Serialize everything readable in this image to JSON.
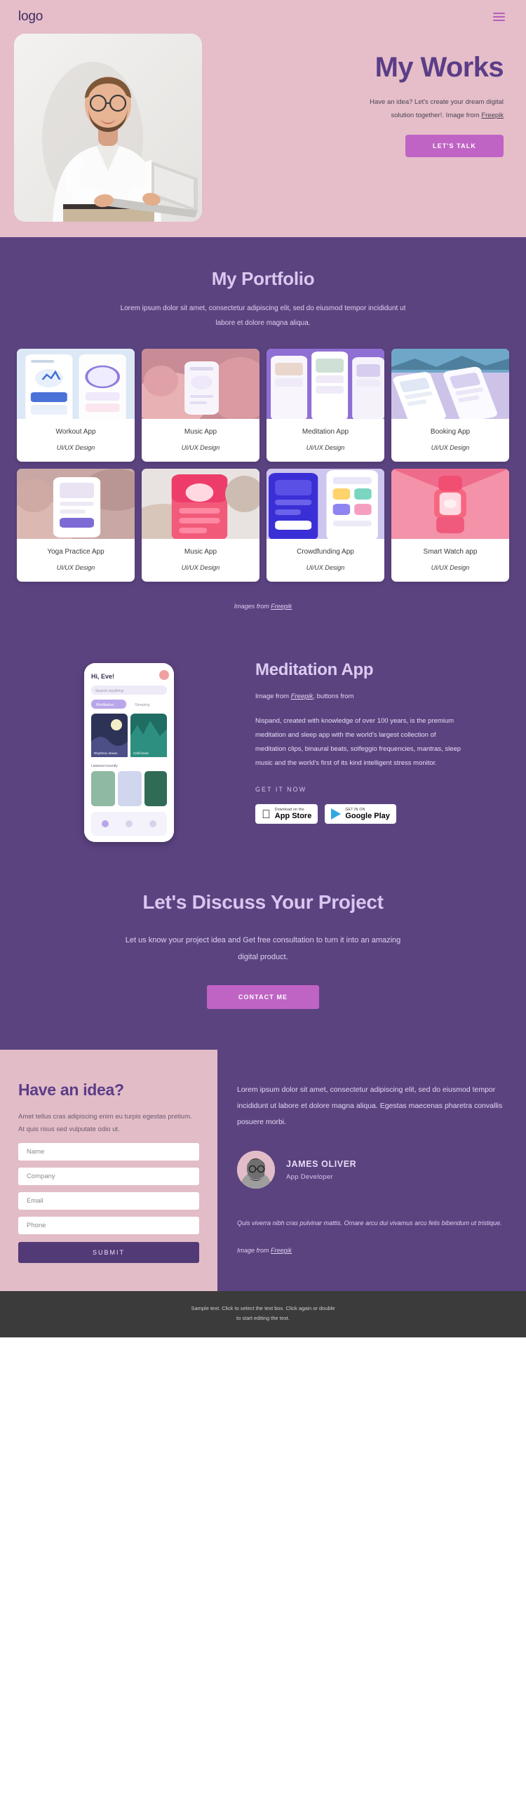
{
  "header": {
    "logo": "logo",
    "menu_icon": "hamburger-icon"
  },
  "hero": {
    "title": "My Works",
    "subtitle_line1": "Have an idea? Let's create your dream digital",
    "subtitle_line2_pre": "solution together!.  Image from ",
    "subtitle_link": "Freepik",
    "cta": "LET'S TALK"
  },
  "portfolio": {
    "title": "My Portfolio",
    "subtitle": "Lorem ipsum dolor sit amet, consectetur adipiscing elit, sed do eiusmod tempor incididunt ut labore et dolore magna aliqua.",
    "credit_pre": "Images from ",
    "credit_link": "Freepik",
    "items": [
      {
        "name": "Workout App",
        "tag": "UI/UX Design"
      },
      {
        "name": "Music App",
        "tag": "UI/UX Design"
      },
      {
        "name": "Meditation App",
        "tag": "UI/UX Design"
      },
      {
        "name": "Booking  App",
        "tag": "UI/UX Design"
      },
      {
        "name": "Yoga Practice App",
        "tag": "UI/UX Design"
      },
      {
        "name": "Music App",
        "tag": "UI/UX Design"
      },
      {
        "name": "Crowdfunding App",
        "tag": "UI/UX Design"
      },
      {
        "name": "Smart Watch app",
        "tag": "UI/UX Design"
      }
    ]
  },
  "meditation": {
    "title": "Meditation App",
    "credit_pre": "Image from ",
    "credit_link": "Freepik",
    "credit_post": ", buttons from",
    "body": "Nispand, created with knowledge of over 100 years, is the premium meditation and sleep app with the world’s largest collection of meditation clips, binaural beats, solfeggio frequencies, mantras, sleep music and the world's first of its kind intelligent stress monitor.",
    "get_it_now": "GET IT NOW",
    "appstore_small": "Download on the",
    "appstore_big": "App Store",
    "play_small": "GET IN ON",
    "play_big": "Google Play",
    "phone_greeting": "Hi, Eve!",
    "phone_search": "Search anything",
    "phone_tab1": "Meditation",
    "phone_tab2": "Sleeping",
    "phone_card1": "Rhythmic dream",
    "phone_card2": "Chill forest",
    "phone_section": "Listened recently"
  },
  "discuss": {
    "title": "Let's Discuss Your Project",
    "body": "Let us know your project idea and Get free consultation to turn it into an amazing digital product.",
    "cta": "CONTACT ME"
  },
  "idea": {
    "title": "Have an idea?",
    "body": "Amet tellus cras adipiscing enim eu turpis egestas pretium. At quis risus sed vulputate odio ut.",
    "fields": [
      {
        "name": "name",
        "placeholder": "Name",
        "value": ""
      },
      {
        "name": "company",
        "placeholder": "Company",
        "value": ""
      },
      {
        "name": "email",
        "placeholder": "Email",
        "value": ""
      },
      {
        "name": "phone",
        "placeholder": "Phone",
        "value": ""
      }
    ],
    "submit": "SUBMIT",
    "lead": "Lorem ipsum dolor sit amet, consectetur adipiscing elit, sed do eiusmod tempor incididunt ut labore et dolore magna aliqua. Egestas maecenas pharetra convallis posuere morbi.",
    "person_name": "JAMES OLIVER",
    "person_role": "App Developer",
    "quote": "Quis viverra nibh cras pulvinar mattis. Ornare arcu dui vivamus arcu felis bibendum ut tristique.",
    "img_credit_pre": "Image from ",
    "img_credit_link": "Freepik"
  },
  "footer": {
    "line1": "Sample text. Click to select the text box. Click again or double",
    "line2": "to start editing the text."
  },
  "colors": {
    "hero_bg": "#e5bec9",
    "purple": "#5b4380",
    "deep_purple": "#5b3d87",
    "accent_pink": "#bf63c4",
    "light_lavender": "#d9c8ef",
    "footer_bg": "#3b3b3b"
  }
}
